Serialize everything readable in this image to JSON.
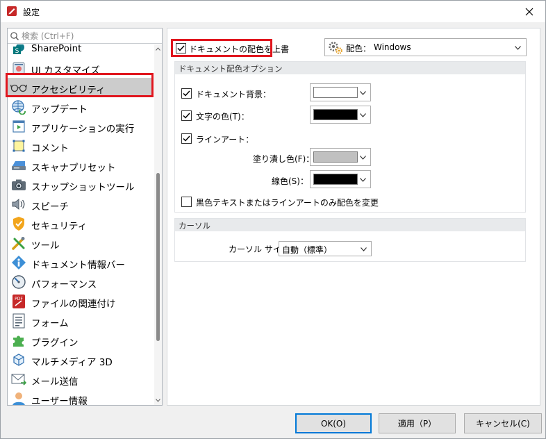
{
  "window": {
    "title": "設定"
  },
  "search": {
    "placeholder": "検索 (Ctrl+F)"
  },
  "nav": {
    "items": [
      {
        "label": "SharePoint",
        "icon": "sharepoint-icon"
      },
      {
        "label": "UI カスタマイズ",
        "icon": "ui-customize-icon"
      },
      {
        "label": "アクセシビリティ",
        "icon": "glasses-icon",
        "selected": true
      },
      {
        "label": "アップデート",
        "icon": "globe-update-icon"
      },
      {
        "label": "アプリケーションの実行",
        "icon": "run-app-icon"
      },
      {
        "label": "コメント",
        "icon": "comment-icon"
      },
      {
        "label": "スキャナプリセット",
        "icon": "scanner-icon"
      },
      {
        "label": "スナップショットツール",
        "icon": "camera-icon"
      },
      {
        "label": "スピーチ",
        "icon": "speaker-icon"
      },
      {
        "label": "セキュリティ",
        "icon": "shield-icon"
      },
      {
        "label": "ツール",
        "icon": "tools-icon"
      },
      {
        "label": "ドキュメント情報バー",
        "icon": "info-icon"
      },
      {
        "label": "パフォーマンス",
        "icon": "gauge-icon"
      },
      {
        "label": "ファイルの関連付け",
        "icon": "pdf-icon"
      },
      {
        "label": "フォーム",
        "icon": "form-icon"
      },
      {
        "label": "プラグイン",
        "icon": "puzzle-icon"
      },
      {
        "label": "マルチメディア 3D",
        "icon": "cube-icon"
      },
      {
        "label": "メール送信",
        "icon": "mail-icon"
      },
      {
        "label": "ユーザー情報",
        "icon": "user-icon"
      }
    ]
  },
  "accessibility": {
    "override_label": "ドキュメントの配色を上書",
    "override_checked": true,
    "scheme_label": "配色：",
    "scheme_value": "Windows",
    "doc_section_title": "ドキュメント配色オプション",
    "doc_background_label": "ドキュメント背景：",
    "doc_background_checked": true,
    "doc_background_color": "#ffffff",
    "text_color_label": "文字の色(T)：",
    "text_color_checked": true,
    "text_color": "#000000",
    "lineart_label": "ラインアート：",
    "lineart_checked": true,
    "fill_label": "塗り潰し色(F)：",
    "fill_color": "#c0c0c0",
    "line_label": "線色(S)：",
    "line_color": "#000000",
    "black_only_label": "黒色テキストまたはラインアートのみ配色を変更",
    "black_only_checked": false,
    "cursor_section_title": "カーソル",
    "cursor_size_label": "カーソル サイズ",
    "cursor_size_value": "自動（標準）"
  },
  "buttons": {
    "ok": "OK(O)",
    "apply": "適用（P）",
    "cancel": "キャンセル(C)"
  },
  "colors": {
    "highlight": "#e0161e",
    "selection": "#cccccc",
    "accent": "#0078d7"
  }
}
